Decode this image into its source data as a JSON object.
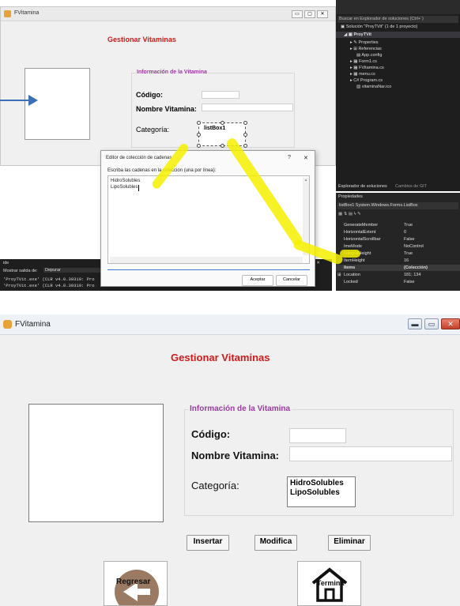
{
  "top": {
    "window_title": "FVitamina",
    "form_heading": "Gestionar Vitaminas",
    "groupbox_title": "Información de la Vitamina",
    "labels": {
      "codigo": "Código:",
      "nombre": "Nombre Vitamina:",
      "categoria": "Categoría:"
    },
    "listbox_label": "listBox1",
    "dialog": {
      "title": "Editor de colección de cadenas",
      "help_char": "?",
      "close_char": "✕",
      "instruction": "Escriba las cadenas en la colección (una por línea):",
      "lines": [
        "HidroSolubles",
        "LipoSolubles"
      ],
      "accept_label": "Aceptar",
      "cancel_label": "Cancelar"
    },
    "solution_explorer": {
      "search_placeholder": "Buscar en Explorador de soluciones (Ctrl+`)",
      "solution": "Solución \"ProyTVit\" (1 de 1 proyecto)",
      "project": "ProyTVit",
      "items": [
        "Properties",
        "Referencias",
        "App.config",
        "Form1.cs",
        "FVitamina.cs",
        "menu.cs",
        "Program.cs",
        "vitaminaNar.ico"
      ],
      "bottom_tabs": [
        "Explorador de soluciones",
        "Cambios de GIT"
      ]
    },
    "properties": {
      "header": "Propiedades",
      "object": "listBox1 System.Windows.Forms.ListBox",
      "rows": [
        {
          "name": "GenerateMember",
          "value": "True"
        },
        {
          "name": "HorizontalExtent",
          "value": "0"
        },
        {
          "name": "HorizontalScrollbar",
          "value": "False"
        },
        {
          "name": "ImeMode",
          "value": "NoControl"
        },
        {
          "name": "IntegralHeight",
          "value": "True"
        },
        {
          "name": "ItemHeight",
          "value": "16"
        },
        {
          "name": "Items",
          "value": "(Colección)"
        },
        {
          "name": "Location",
          "value": "181; 134"
        },
        {
          "name": "Locked",
          "value": "False"
        }
      ]
    },
    "output": {
      "title": "ide",
      "show_output_label": "Mostrar salida de:",
      "show_output_value": "Depurar",
      "lines": [
        "'ProyTVit.exe' (CLR v4.0.30319: Pro",
        "'ProyTVit.exe' (CLR v4.0.30319: Pro"
      ],
      "pin": "▾ ✕"
    }
  },
  "bottom": {
    "window_title": "FVitamina",
    "form_heading": "Gestionar Vitaminas",
    "groupbox_title": "Información de la Vitamina",
    "labels": {
      "codigo": "Código:",
      "nombre": "Nombre Vitamina:",
      "categoria": "Categoría:"
    },
    "list_items": [
      "HidroSolubles",
      "LipoSolubles"
    ],
    "buttons": {
      "insertar": "Insertar",
      "modifica": "Modifica",
      "eliminar": "Eliminar"
    },
    "regresar_label": "Regresar",
    "termina_label": "Termina"
  }
}
